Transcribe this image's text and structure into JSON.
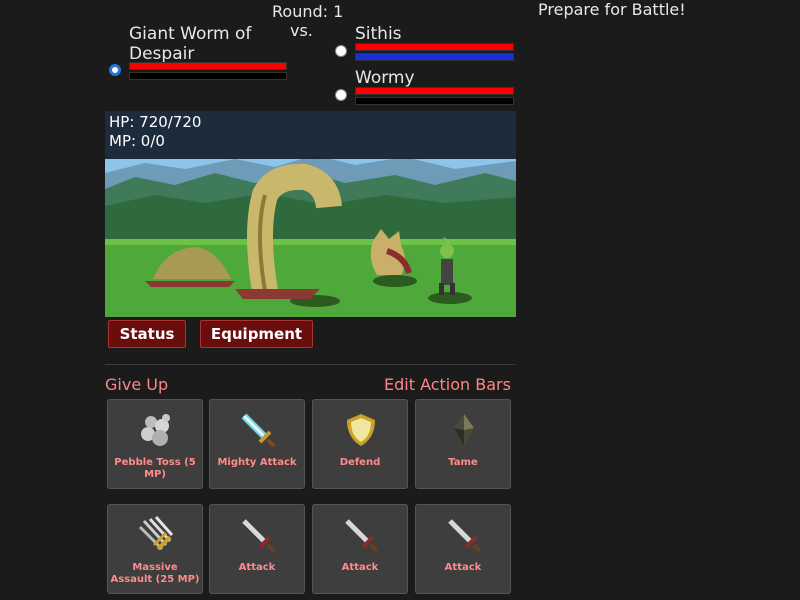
{
  "header": {
    "round_label": "Round: 1",
    "vs_label": "vs.",
    "status_message": "Prepare for Battle!"
  },
  "player": {
    "name": "Giant Worm of Despair",
    "hp_fraction": 1.0,
    "mp_fraction": 0.0
  },
  "enemies": [
    {
      "name": "Sithis",
      "hp_fraction": 1.0,
      "mp_fraction": 1.0
    },
    {
      "name": "Wormy",
      "hp_fraction": 1.0,
      "mp_fraction": 0.0
    }
  ],
  "scene": {
    "hp_text": "HP: 720/720",
    "mp_text": "MP: 0/0"
  },
  "buttons": {
    "status": "Status",
    "equipment": "Equipment"
  },
  "links": {
    "give_up": "Give Up",
    "edit_action_bars": "Edit Action Bars"
  },
  "actions_row1": [
    {
      "label": "Pebble Toss (5 MP)",
      "icon": "pebbles-icon"
    },
    {
      "label": "Mighty Attack",
      "icon": "glowing-sword-icon"
    },
    {
      "label": "Defend",
      "icon": "shield-icon"
    },
    {
      "label": "Tame",
      "icon": "crystal-icon"
    }
  ],
  "actions_row2": [
    {
      "label": "Massive Assault (25 MP)",
      "icon": "swords-bundle-icon"
    },
    {
      "label": "Attack",
      "icon": "sword-icon"
    },
    {
      "label": "Attack",
      "icon": "sword-icon"
    },
    {
      "label": "Attack",
      "icon": "sword-icon"
    }
  ],
  "colors": {
    "hp_bar": "#ff0000",
    "mp_bar": "#1a2fd6",
    "accent_link": "#ff8585",
    "button_bg": "#6a0d0d"
  }
}
